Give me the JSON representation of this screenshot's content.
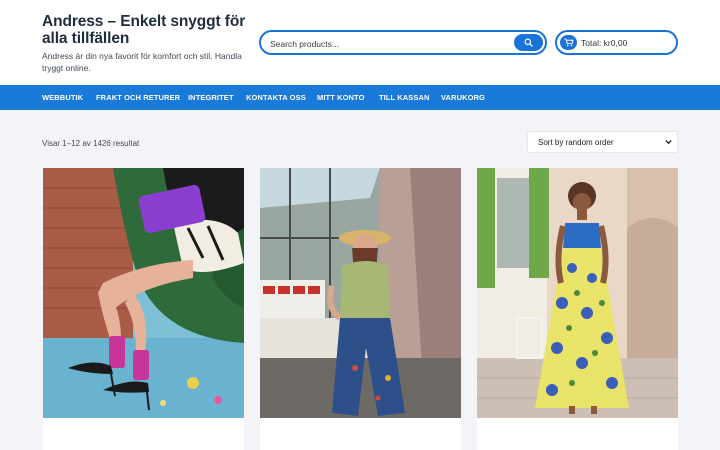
{
  "header": {
    "site_title": "Andress – Enkelt snyggt för alla tillfällen",
    "site_description": "Andress är din nya favorit för komfort och stil. Handla tryggt online."
  },
  "search": {
    "placeholder": "Search products...",
    "icon": "search-icon"
  },
  "cart": {
    "label": "Total: kr0,00",
    "icon": "cart-icon"
  },
  "nav": {
    "items": [
      {
        "label": "WEBBUTIK"
      },
      {
        "label": "FRAKT OCH RETURER"
      },
      {
        "label": "INTEGRITET"
      },
      {
        "label": "KONTAKTA OSS"
      },
      {
        "label": "MITT KONTO"
      },
      {
        "label": "TILL KASSAN"
      },
      {
        "label": "VARUKORG"
      }
    ]
  },
  "shop": {
    "result_count": "Visar 1–12 av 1426 resultat",
    "sort": {
      "selected": "Sort by random order"
    },
    "products": [
      {
        "image": "Woman with purple clutch and floral socks seated in green armchair"
      },
      {
        "image": "Woman in straw hat and embroidered wide-leg jeans by shop window"
      },
      {
        "image": "Woman in yellow and blue floral sundress on a street"
      }
    ]
  },
  "colors": {
    "accent": "#1a73d9",
    "nav_background": "#1a7ad9",
    "page_background": "#f2f4f7"
  }
}
